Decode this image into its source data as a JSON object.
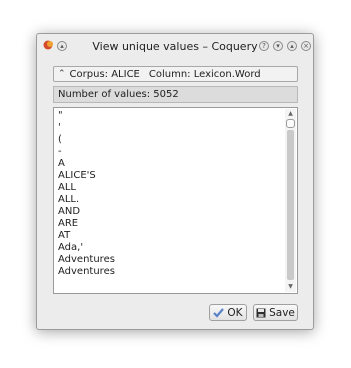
{
  "window": {
    "title": "View unique values – Coquery"
  },
  "corpus_bar": {
    "caret": "⌃",
    "corpus_label": "Corpus: ALICE",
    "column_label": "Column: Lexicon.Word"
  },
  "count": {
    "text": "Number of values: 5052"
  },
  "values": [
    "\"",
    "'",
    "(",
    "-",
    "A",
    "ALICE'S",
    "ALL",
    "ALL.",
    "AND",
    "ARE",
    "AT",
    "Ada,'",
    "Adventures",
    "Adventures"
  ],
  "buttons": {
    "ok_label": "OK",
    "save_label": "Save"
  },
  "icons": {
    "app": "coquery-app-icon",
    "titlebar_left": "pin-icon",
    "titlebar_right": [
      "help-icon",
      "minimize-icon",
      "maximize-icon",
      "close-icon"
    ],
    "ok": "checkmark-icon",
    "save": "floppy-disk-icon"
  },
  "colors": {
    "ok_check": "#5a82c9",
    "save_icon": "#2f2f2f"
  }
}
